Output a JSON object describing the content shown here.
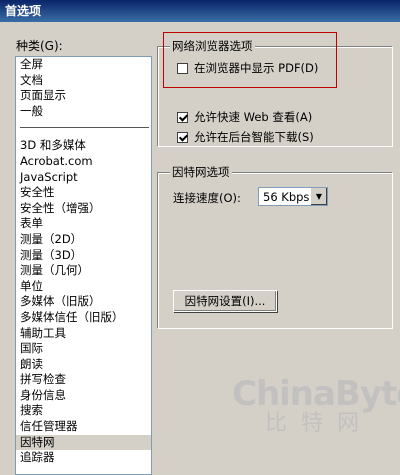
{
  "window": {
    "title": "首选项"
  },
  "categories": {
    "label": "种类(G):",
    "group1": [
      "全屏",
      "文档",
      "页面显示",
      "一般"
    ],
    "group2": [
      "3D 和多媒体",
      "Acrobat.com",
      "JavaScript",
      "安全性",
      "安全性（增强）",
      "表单",
      "测量（2D）",
      "测量（3D）",
      "测量（几何）",
      "单位",
      "多媒体（旧版）",
      "多媒体信任（旧版）",
      "辅助工具",
      "国际",
      "朗读",
      "拼写检查",
      "身份信息",
      "搜索",
      "信任管理器",
      "因特网",
      "追踪器"
    ],
    "selected": "因特网"
  },
  "browser_group": {
    "title": "网络浏览器选项",
    "show_in_browser": {
      "label": "在浏览器中显示 PDF(D)",
      "checked": false
    },
    "fast_web_view": {
      "label": "允许快速 Web 查看(A)",
      "checked": true
    },
    "background_download": {
      "label": "允许在后台智能下载(S)",
      "checked": true
    }
  },
  "internet_group": {
    "title": "因特网选项",
    "speed_label": "连接速度(O):",
    "speed_value": "56 Kbps",
    "settings_button": "因特网设置(I)..."
  },
  "watermark": {
    "line1": "ChinaByte",
    "line2": "比特网"
  }
}
